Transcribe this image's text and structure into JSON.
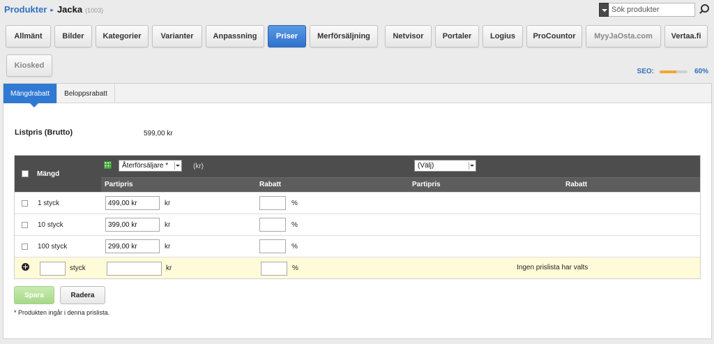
{
  "breadcrumb": {
    "root": "Produkter",
    "separator": "▸",
    "name": "Jacka",
    "id": "(1003)"
  },
  "search": {
    "placeholder": "Sök produkter"
  },
  "tabs": [
    {
      "label": "Allmänt",
      "active": false
    },
    {
      "label": "Bilder",
      "active": false
    },
    {
      "label": "Kategorier",
      "active": false
    },
    {
      "label": "Varianter",
      "active": false
    },
    {
      "label": "Anpassning",
      "active": false
    },
    {
      "label": "Priser",
      "active": true
    },
    {
      "label": "Merförsäljning",
      "active": false
    },
    {
      "label": "Netvisor",
      "active": false
    },
    {
      "label": "Portaler",
      "active": false
    },
    {
      "label": "Logius",
      "active": false
    },
    {
      "label": "ProCountor",
      "active": false
    },
    {
      "label": "MyyJaOsta.com",
      "active": false
    },
    {
      "label": "Vertaa.fi",
      "active": false
    },
    {
      "label": "Kiosked",
      "active": false
    }
  ],
  "seo": {
    "label": "SEO:",
    "value": "60%",
    "fraction": 0.6
  },
  "subtabs": [
    {
      "label": "Mängdrabatt",
      "active": true
    },
    {
      "label": "Beloppsrabatt",
      "active": false
    }
  ],
  "listpris": {
    "label": "Listpris (Brutto)",
    "value": "599,00 kr"
  },
  "table": {
    "mangd_header": "Mängd",
    "pricelist1_select": "Återförsäljare *",
    "pricelist1_unit": "(kr)",
    "pricelist2_select": "(Välj)",
    "col_partipris": "Partipris",
    "col_rabatt": "Rabatt",
    "col_partipris2": "Partipris",
    "col_rabatt2": "Rabatt",
    "rows": [
      {
        "label": "1 styck",
        "partipris": "499,00 kr",
        "kr": "kr",
        "rabatt": "",
        "pct": "%"
      },
      {
        "label": "10 styck",
        "partipris": "399,00 kr",
        "kr": "kr",
        "rabatt": "",
        "pct": "%"
      },
      {
        "label": "100 styck",
        "partipris": "299,00 kr",
        "kr": "kr",
        "rabatt": "",
        "pct": "%"
      }
    ],
    "new_row": {
      "qty": "",
      "unit": "styck",
      "partipris": "",
      "kr": "kr",
      "rabatt": "",
      "pct": "%",
      "message": "Ingen prislista har valts"
    }
  },
  "buttons": {
    "save": "Spara",
    "delete": "Radera"
  },
  "footnote": "* Produkten ingår i denna prislista."
}
